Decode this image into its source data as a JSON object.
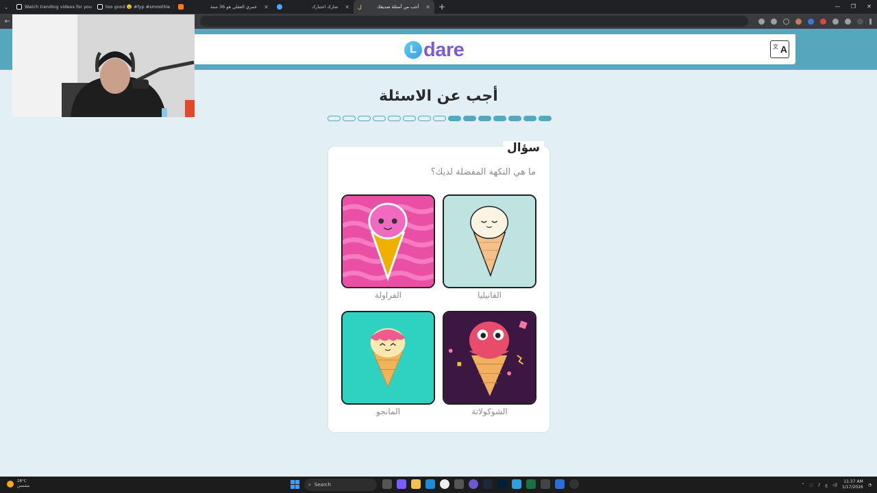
{
  "browser": {
    "tabs": [
      {
        "label": "Watch trending videos for you",
        "color": "#ffffff",
        "active": false
      },
      {
        "label": "too good 🤤 #fyp #smoothie",
        "color": "#ffffff",
        "active": false
      },
      {
        "label": "",
        "color": "#ff7a1a",
        "active": false
      },
      {
        "label": "عمري العقلي هو 36 سنة",
        "color": "#ffffff",
        "active": false
      },
      {
        "label": "شارك اختبارك",
        "color": "#4aa8ff",
        "active": false
      },
      {
        "label": "أجب من أسئلة صديقك",
        "color": "#ffd84a",
        "active": true
      }
    ],
    "new_tab": "+",
    "window_controls": [
      "—",
      "❐",
      "✕"
    ]
  },
  "site": {
    "logo_letter": "L",
    "logo_text": "dare",
    "lang_button": "A",
    "lang_glyph": "文"
  },
  "page": {
    "title": "أجب عن الاسئلة",
    "progress_total": 15,
    "progress_completed": 7
  },
  "question": {
    "tag": "سؤال",
    "text": "ما هي النكهة المفضلة لديك؟",
    "options": [
      {
        "label": "الفانيليا",
        "bg": "#bfe3e0"
      },
      {
        "label": "الفراولة",
        "bg": "#ea4fa6"
      },
      {
        "label": "الشوكولاتة",
        "bg": "#3b1742"
      },
      {
        "label": "المانجو",
        "bg": "#2fd1c0"
      }
    ]
  },
  "taskbar": {
    "weather_temp": "28°C",
    "weather_desc": "مشمس",
    "search_placeholder": "Search",
    "time": "11:37 AM",
    "date": "1/17/2026",
    "lang": "ع"
  }
}
